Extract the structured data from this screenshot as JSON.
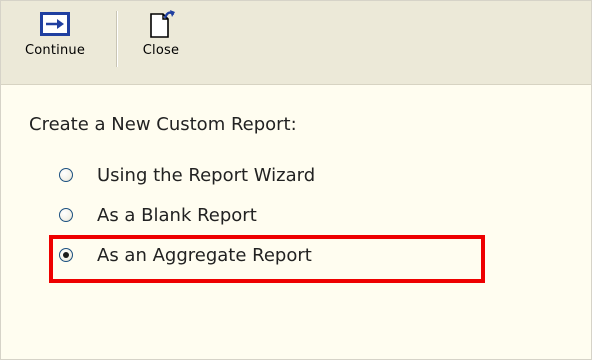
{
  "toolbar": {
    "continue_label": "Continue",
    "continue_icon": "arrow-right-icon",
    "close_label": "Close",
    "close_icon": "page-close-icon"
  },
  "form": {
    "heading": "Create a New Custom Report:",
    "options": [
      {
        "label": "Using the Report Wizard",
        "selected": false
      },
      {
        "label": "As a Blank Report",
        "selected": false
      },
      {
        "label": "As an Aggregate Report",
        "selected": true
      }
    ]
  },
  "colors": {
    "toolbar_bg": "#ece9d8",
    "content_bg": "#fffdf0",
    "highlight": "#ee0000",
    "icon_blue": "#1f3fa0"
  }
}
